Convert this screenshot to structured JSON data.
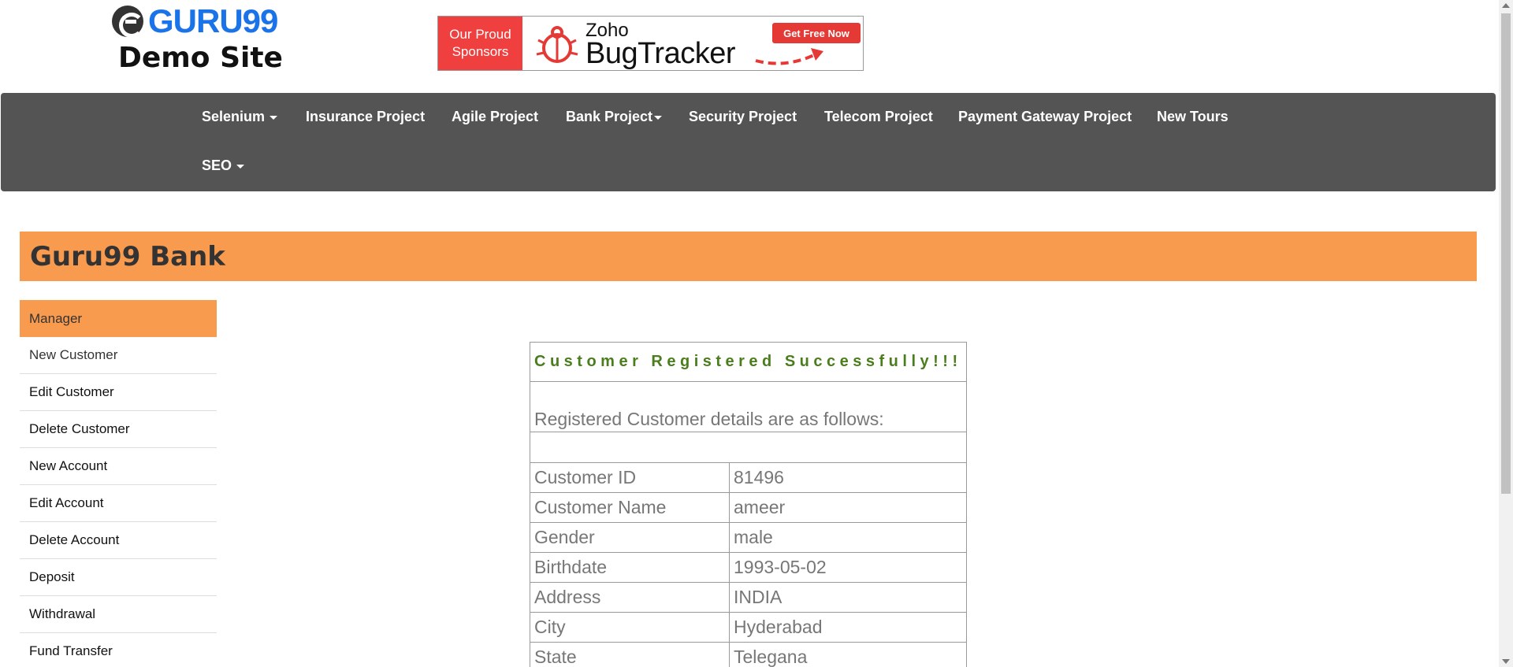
{
  "header": {
    "logo_text": "GURU99",
    "subtitle": "Demo Site"
  },
  "banner": {
    "left_line1": "Our Proud",
    "left_line2": "Sponsors",
    "brand_line1": "Zoho",
    "brand_line2": "BugTracker",
    "cta": "Get Free Now"
  },
  "nav": {
    "items": [
      {
        "label": "Selenium",
        "dropdown": true
      },
      {
        "label": "Insurance Project",
        "dropdown": false
      },
      {
        "label": "Agile Project",
        "dropdown": false
      },
      {
        "label": "Bank Project",
        "dropdown": true
      },
      {
        "label": "Security Project",
        "dropdown": false
      },
      {
        "label": "Telecom Project",
        "dropdown": false
      },
      {
        "label": "Payment Gateway Project",
        "dropdown": false
      },
      {
        "label": "New Tours",
        "dropdown": false
      },
      {
        "label": "SEO",
        "dropdown": true
      }
    ]
  },
  "bank": {
    "title": "Guru99 Bank"
  },
  "sidebar": {
    "items": [
      {
        "label": "Manager"
      },
      {
        "label": "New Customer"
      },
      {
        "label": "Edit Customer"
      },
      {
        "label": "Delete Customer"
      },
      {
        "label": "New Account"
      },
      {
        "label": "Edit Account"
      },
      {
        "label": "Delete Account"
      },
      {
        "label": "Deposit"
      },
      {
        "label": "Withdrawal"
      },
      {
        "label": "Fund Transfer"
      }
    ]
  },
  "result": {
    "heading": "Customer Registered Successfully!!!",
    "subheading": "Registered Customer details are as follows:",
    "rows": [
      {
        "label": "Customer ID",
        "value": "81496"
      },
      {
        "label": "Customer Name",
        "value": "ameer"
      },
      {
        "label": "Gender",
        "value": "male"
      },
      {
        "label": "Birthdate",
        "value": "1993-05-02"
      },
      {
        "label": "Address",
        "value": "INDIA"
      },
      {
        "label": "City",
        "value": "Hyderabad"
      },
      {
        "label": "State",
        "value": "Telegana"
      }
    ]
  },
  "colors": {
    "nav_bg": "#545454",
    "accent_orange": "#f89b4e",
    "success_green": "#4a7d1c",
    "logo_blue": "#1a73e8",
    "banner_red": "#ef3f3f"
  }
}
